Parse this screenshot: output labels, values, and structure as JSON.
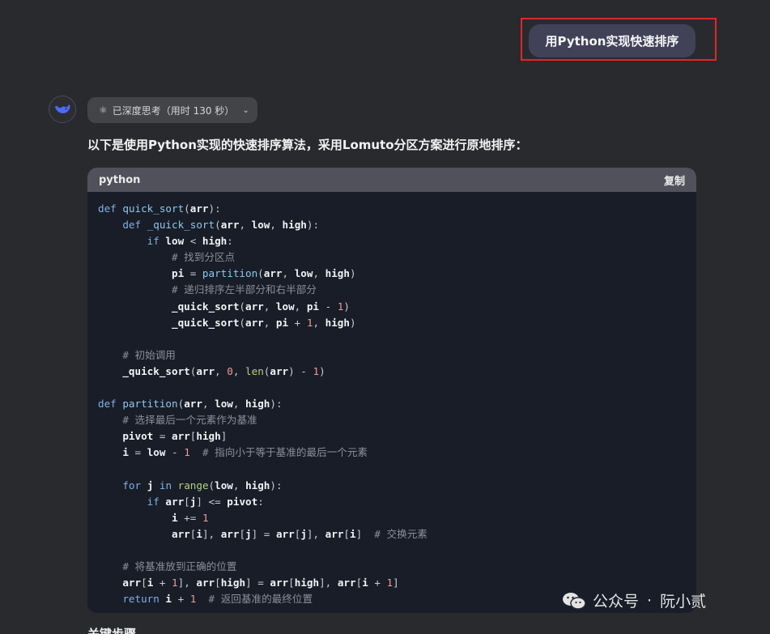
{
  "user_message": "用Python实现快速排序",
  "thinking": {
    "label": "已深度思考（用时 130 秒）",
    "icon": "atom-icon"
  },
  "assistant": {
    "intro": "以下是使用Python实现的快速排序算法，采用Lomuto分区方案进行原地排序：",
    "next_heading": "关键步骤"
  },
  "code_block": {
    "language": "python",
    "copy_label": "复制",
    "lines": [
      [
        [
          "kw",
          "def "
        ],
        [
          "fn",
          "quick_sort"
        ],
        [
          "op",
          "("
        ],
        [
          "id",
          "arr"
        ],
        [
          "op",
          "):"
        ]
      ],
      [
        [
          "",
          "    "
        ],
        [
          "kw",
          "def "
        ],
        [
          "fn",
          "_quick_sort"
        ],
        [
          "op",
          "("
        ],
        [
          "id",
          "arr"
        ],
        [
          "op",
          ", "
        ],
        [
          "id",
          "low"
        ],
        [
          "op",
          ", "
        ],
        [
          "id",
          "high"
        ],
        [
          "op",
          "):"
        ]
      ],
      [
        [
          "",
          "        "
        ],
        [
          "kw",
          "if "
        ],
        [
          "id",
          "low"
        ],
        [
          "op",
          " < "
        ],
        [
          "id",
          "high"
        ],
        [
          "op",
          ":"
        ]
      ],
      [
        [
          "",
          "            "
        ],
        [
          "cm",
          "# 找到分区点"
        ]
      ],
      [
        [
          "",
          "            "
        ],
        [
          "id",
          "pi"
        ],
        [
          "op",
          " = "
        ],
        [
          "fn",
          "partition"
        ],
        [
          "op",
          "("
        ],
        [
          "id",
          "arr"
        ],
        [
          "op",
          ", "
        ],
        [
          "id",
          "low"
        ],
        [
          "op",
          ", "
        ],
        [
          "id",
          "high"
        ],
        [
          "op",
          ")"
        ]
      ],
      [
        [
          "",
          "            "
        ],
        [
          "cm",
          "# 递归排序左半部分和右半部分"
        ]
      ],
      [
        [
          "",
          "            "
        ],
        [
          "id",
          "_quick_sort"
        ],
        [
          "op",
          "("
        ],
        [
          "id",
          "arr"
        ],
        [
          "op",
          ", "
        ],
        [
          "id",
          "low"
        ],
        [
          "op",
          ", "
        ],
        [
          "id",
          "pi"
        ],
        [
          "op",
          " - "
        ],
        [
          "num",
          "1"
        ],
        [
          "op",
          ")"
        ]
      ],
      [
        [
          "",
          "            "
        ],
        [
          "id",
          "_quick_sort"
        ],
        [
          "op",
          "("
        ],
        [
          "id",
          "arr"
        ],
        [
          "op",
          ", "
        ],
        [
          "id",
          "pi"
        ],
        [
          "op",
          " + "
        ],
        [
          "num",
          "1"
        ],
        [
          "op",
          ", "
        ],
        [
          "id",
          "high"
        ],
        [
          "op",
          ")"
        ]
      ],
      [],
      [
        [
          "",
          "    "
        ],
        [
          "cm",
          "# 初始调用"
        ]
      ],
      [
        [
          "",
          "    "
        ],
        [
          "id",
          "_quick_sort"
        ],
        [
          "op",
          "("
        ],
        [
          "id",
          "arr"
        ],
        [
          "op",
          ", "
        ],
        [
          "num",
          "0"
        ],
        [
          "op",
          ", "
        ],
        [
          "bi",
          "len"
        ],
        [
          "op",
          "("
        ],
        [
          "id",
          "arr"
        ],
        [
          "op",
          ") - "
        ],
        [
          "num",
          "1"
        ],
        [
          "op",
          ")"
        ]
      ],
      [],
      [
        [
          "kw",
          "def "
        ],
        [
          "fn",
          "partition"
        ],
        [
          "op",
          "("
        ],
        [
          "id",
          "arr"
        ],
        [
          "op",
          ", "
        ],
        [
          "id",
          "low"
        ],
        [
          "op",
          ", "
        ],
        [
          "id",
          "high"
        ],
        [
          "op",
          "):"
        ]
      ],
      [
        [
          "",
          "    "
        ],
        [
          "cm",
          "# 选择最后一个元素作为基准"
        ]
      ],
      [
        [
          "",
          "    "
        ],
        [
          "id",
          "pivot"
        ],
        [
          "op",
          " = "
        ],
        [
          "id",
          "arr"
        ],
        [
          "op",
          "["
        ],
        [
          "id",
          "high"
        ],
        [
          "op",
          "]"
        ]
      ],
      [
        [
          "",
          "    "
        ],
        [
          "id",
          "i"
        ],
        [
          "op",
          " = "
        ],
        [
          "id",
          "low"
        ],
        [
          "op",
          " - "
        ],
        [
          "num",
          "1"
        ],
        [
          "",
          "  "
        ],
        [
          "cm",
          "# 指向小于等于基准的最后一个元素"
        ]
      ],
      [],
      [
        [
          "",
          "    "
        ],
        [
          "kw",
          "for "
        ],
        [
          "id",
          "j"
        ],
        [
          "kw",
          " in "
        ],
        [
          "bi",
          "range"
        ],
        [
          "op",
          "("
        ],
        [
          "id",
          "low"
        ],
        [
          "op",
          ", "
        ],
        [
          "id",
          "high"
        ],
        [
          "op",
          "):"
        ]
      ],
      [
        [
          "",
          "        "
        ],
        [
          "kw",
          "if "
        ],
        [
          "id",
          "arr"
        ],
        [
          "op",
          "["
        ],
        [
          "id",
          "j"
        ],
        [
          "op",
          "] <= "
        ],
        [
          "id",
          "pivot"
        ],
        [
          "op",
          ":"
        ]
      ],
      [
        [
          "",
          "            "
        ],
        [
          "id",
          "i"
        ],
        [
          "op",
          " += "
        ],
        [
          "num",
          "1"
        ]
      ],
      [
        [
          "",
          "            "
        ],
        [
          "id",
          "arr"
        ],
        [
          "op",
          "["
        ],
        [
          "id",
          "i"
        ],
        [
          "op",
          "], "
        ],
        [
          "id",
          "arr"
        ],
        [
          "op",
          "["
        ],
        [
          "id",
          "j"
        ],
        [
          "op",
          "] = "
        ],
        [
          "id",
          "arr"
        ],
        [
          "op",
          "["
        ],
        [
          "id",
          "j"
        ],
        [
          "op",
          "], "
        ],
        [
          "id",
          "arr"
        ],
        [
          "op",
          "["
        ],
        [
          "id",
          "i"
        ],
        [
          "op",
          "]"
        ],
        [
          "",
          "  "
        ],
        [
          "cm",
          "# 交换元素"
        ]
      ],
      [],
      [
        [
          "",
          "    "
        ],
        [
          "cm",
          "# 将基准放到正确的位置"
        ]
      ],
      [
        [
          "",
          "    "
        ],
        [
          "id",
          "arr"
        ],
        [
          "op",
          "["
        ],
        [
          "id",
          "i"
        ],
        [
          "op",
          " + "
        ],
        [
          "num",
          "1"
        ],
        [
          "op",
          "], "
        ],
        [
          "id",
          "arr"
        ],
        [
          "op",
          "["
        ],
        [
          "id",
          "high"
        ],
        [
          "op",
          "] = "
        ],
        [
          "id",
          "arr"
        ],
        [
          "op",
          "["
        ],
        [
          "id",
          "high"
        ],
        [
          "op",
          "], "
        ],
        [
          "id",
          "arr"
        ],
        [
          "op",
          "["
        ],
        [
          "id",
          "i"
        ],
        [
          "op",
          " + "
        ],
        [
          "num",
          "1"
        ],
        [
          "op",
          "]"
        ]
      ],
      [
        [
          "",
          "    "
        ],
        [
          "kw",
          "return "
        ],
        [
          "id",
          "i"
        ],
        [
          "op",
          " + "
        ],
        [
          "num",
          "1"
        ],
        [
          "",
          "  "
        ],
        [
          "cm",
          "# 返回基准的最终位置"
        ]
      ]
    ]
  },
  "watermark": {
    "icon": "wechat-icon",
    "source": "公众号",
    "separator": "·",
    "author": "阮小贰"
  },
  "colors": {
    "background": "#292a2d",
    "user_bubble": "#414158",
    "highlight_box": "#e0262a",
    "code_bg": "#181d27",
    "code_header": "#50515a"
  }
}
